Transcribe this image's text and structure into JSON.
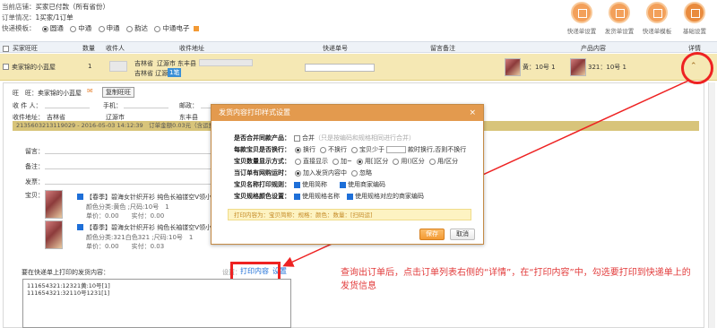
{
  "info": {
    "line1_label": "当前店铺：",
    "line1_value": "买家已付款（所有省份）",
    "line2_label": "订单情况：",
    "line2_value": "1买家/1订单",
    "line3_label": "快递模板：",
    "couriers": [
      "圆通",
      "中通",
      "申通",
      "韵达",
      "中通电子"
    ],
    "selected_courier_index": 0
  },
  "toolbar": [
    {
      "label": "快递单设置",
      "icon": "document-icon"
    },
    {
      "label": "发货单设置",
      "icon": "document-icon"
    },
    {
      "label": "快递单模板",
      "icon": "document-icon"
    },
    {
      "label": "基础设置",
      "icon": "tools-icon"
    }
  ],
  "table_header": {
    "buyer": "买家旺旺",
    "qty": "数量",
    "receiver": "收件人",
    "address": "收件地址",
    "tracking": "快递单号",
    "remark": "留言备注",
    "product": "产品内容",
    "detail": "详情"
  },
  "order_row": {
    "buyer": "卖家锦的小蓝屋",
    "qty": "1",
    "address_province": "吉林省",
    "address_city": "辽源市",
    "address_district": "东丰县",
    "address_line2": "吉林省 辽源",
    "tag": "1笔",
    "product1": "黄：10号 1",
    "product2": "321：10号 1"
  },
  "detail": {
    "ww_label": "旺　旺：",
    "ww_value": "卖家锦的小蓝屋",
    "copy_button": "复制旺旺",
    "receiver_label": "收 件 人：",
    "phone_label": "手机：",
    "zip_label": "邮政：",
    "tel_label": "电话：",
    "address_label": "收件地址：",
    "province": "吉林省",
    "city": "辽源市",
    "district": "东丰县",
    "order_bar": "2135603213119029 - 2016-05-03 14:12:39　订单金额0.03元（含运费0.00元）",
    "msg_label": "留言：",
    "remark_label": "备注：",
    "attach_label": "发票：",
    "goods_label": "宝贝：",
    "item1_title": "【春季】碧海女针织开衫 纯色长袖镂空V领小开衫",
    "item1_color": "颜色分类:黄色 ;尺码:10号　1",
    "item1_price": "单价：0.00　　实付：0.00",
    "item2_title": "【春季】碧海女针织开衫 纯色长袖镂空V领小开衫",
    "item2_color": "颜色分类:321白色321 ;尺码:10号　1",
    "item2_price": "单价：0.00　　实付：0.03",
    "print_label": "要在快递单上打印的发货内容：",
    "settings_prefix": "设置：",
    "print_content_link": "打印内容",
    "settings_link": "设置",
    "print_text_line1": "111654321:12321黄:10号[1]",
    "print_text_line2": "111654321:32110号1231[1]"
  },
  "modal": {
    "title": "发货内容打印样式设置",
    "close": "×",
    "merge_label": "是否合并同款产品：",
    "merge_option": "合并",
    "merge_hint": "（只是按编码和规格相同进行合并）",
    "newline_label": "每款宝贝是否换行：",
    "newline_options": [
      "换行",
      "不换行",
      "宝贝少于"
    ],
    "newline_suffix": "款时换行,否则不换行",
    "qty_label": "宝贝数量显示方式：",
    "qty_options": [
      "直接显示",
      "加~",
      "用[]区分",
      "用()区分",
      "用/区分"
    ],
    "combine_label": "当订单有网购运时：",
    "combine_options": [
      "加入发货内容中",
      "忽略"
    ],
    "name_label": "宝贝名称打印规则：",
    "name_options": [
      "使用简称",
      "使用商家编码"
    ],
    "sku_label": "宝贝规格颜色设置：",
    "sku_options": [
      "使用规格名称",
      "使用规格对应的商家编码"
    ],
    "preview": "打印内容为：宝贝简称：规格：颜色：数量：[扫码运]",
    "save": "保存",
    "cancel": "取消"
  },
  "annotation": "查询出订单后，点击订单列表右侧的“详情”，在“打印内容”中，勾选要打印到快递单上的发货信息",
  "colors": {
    "accent_orange": "#e39a4e",
    "order_row_bg": "#f5e8b4",
    "annotation_red": "#e23b3b"
  }
}
